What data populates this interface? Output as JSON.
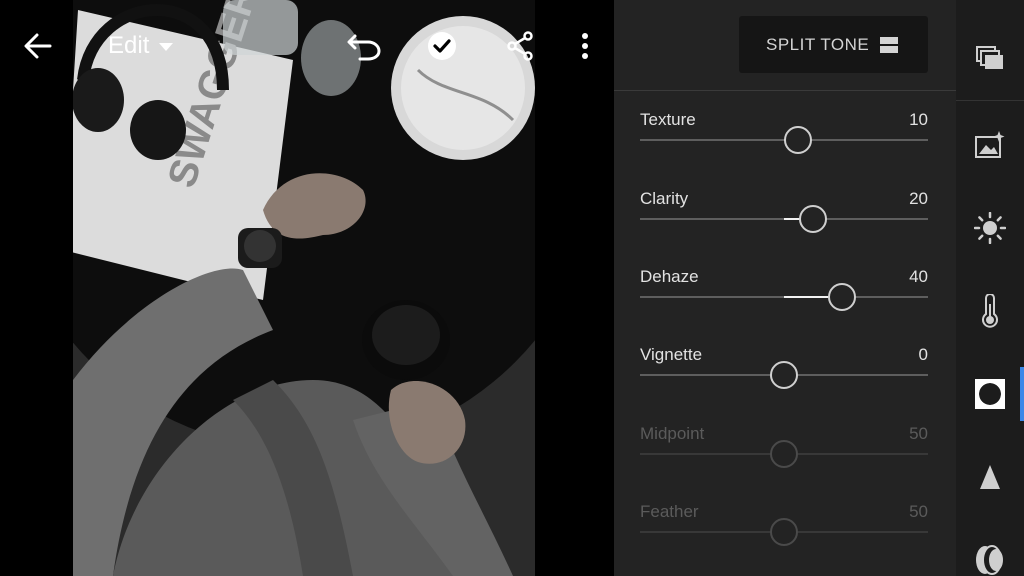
{
  "topbar": {
    "edit_label": "Edit"
  },
  "panel": {
    "header_button_label": "SPLIT TONE",
    "sliders": [
      {
        "label": "Texture",
        "value": "10",
        "level": 10,
        "enabled": true
      },
      {
        "label": "Clarity",
        "value": "20",
        "level": 20,
        "enabled": true
      },
      {
        "label": "Dehaze",
        "value": "40",
        "level": 40,
        "enabled": true
      },
      {
        "label": "Vignette",
        "value": "0",
        "level": 0,
        "enabled": true
      },
      {
        "label": "Midpoint",
        "value": "50",
        "level": 50,
        "enabled": false
      },
      {
        "label": "Feather",
        "value": "50",
        "level": 50,
        "enabled": false
      }
    ]
  },
  "rail": {
    "items": [
      {
        "name": "presets-icon"
      },
      {
        "name": "auto-enhance-icon"
      },
      {
        "name": "light-icon"
      },
      {
        "name": "color-icon"
      },
      {
        "name": "effects-icon",
        "active": true
      },
      {
        "name": "detail-icon"
      },
      {
        "name": "optics-icon"
      }
    ]
  },
  "colors": {
    "accent": "#3b87e8",
    "panel_bg": "#232323",
    "rail_bg": "#1c1c1c"
  }
}
